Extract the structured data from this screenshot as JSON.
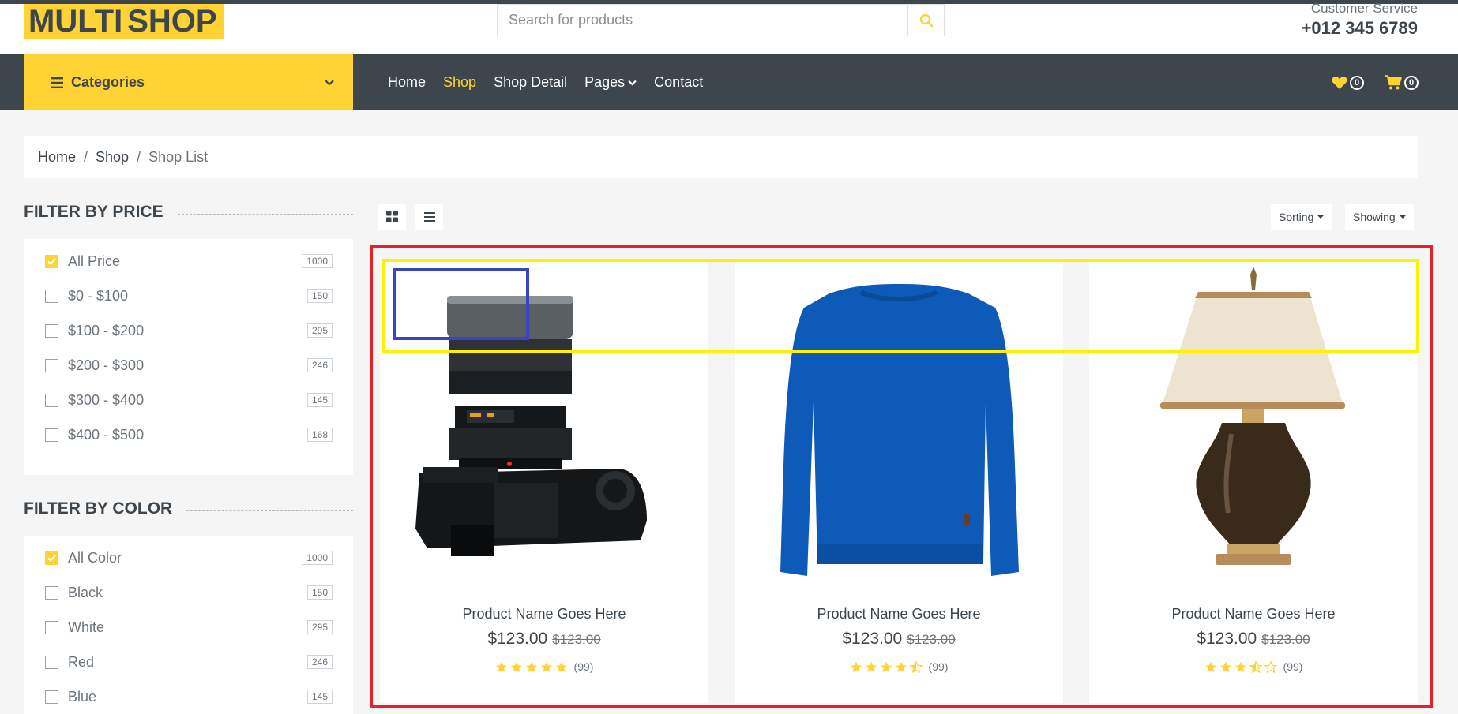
{
  "brand": {
    "part1": "MULTI",
    "part2": "SHOP",
    "accent": "#ffd333",
    "dark": "#3d464d"
  },
  "search": {
    "placeholder": "Search for products"
  },
  "customer_service": {
    "label": "Customer Service",
    "phone": "+012 345 6789"
  },
  "categories": {
    "label": "Categories"
  },
  "nav": {
    "items": [
      {
        "label": "Home"
      },
      {
        "label": "Shop"
      },
      {
        "label": "Shop Detail"
      },
      {
        "label": "Pages"
      },
      {
        "label": "Contact"
      }
    ],
    "active": "Shop",
    "wishlist_count": "0",
    "cart_count": "0"
  },
  "breadcrumb": {
    "items": [
      "Home",
      "Shop"
    ],
    "current": "Shop List",
    "separator": "/"
  },
  "filter_price": {
    "title": "Filter by price",
    "items": [
      {
        "label": "All Price",
        "count": "1000",
        "checked": true
      },
      {
        "label": "$0 - $100",
        "count": "150",
        "checked": false
      },
      {
        "label": "$100 - $200",
        "count": "295",
        "checked": false
      },
      {
        "label": "$200 - $300",
        "count": "246",
        "checked": false
      },
      {
        "label": "$300 - $400",
        "count": "145",
        "checked": false
      },
      {
        "label": "$400 - $500",
        "count": "168",
        "checked": false
      }
    ]
  },
  "filter_color": {
    "title": "Filter by color",
    "items": [
      {
        "label": "All Color",
        "count": "1000",
        "checked": true
      },
      {
        "label": "Black",
        "count": "150",
        "checked": false
      },
      {
        "label": "White",
        "count": "295",
        "checked": false
      },
      {
        "label": "Red",
        "count": "246",
        "checked": false
      },
      {
        "label": "Blue",
        "count": "145",
        "checked": false
      }
    ]
  },
  "toolbar": {
    "sorting_label": "Sorting",
    "showing_label": "Showing"
  },
  "products": [
    {
      "name": "Product Name Goes Here",
      "price": "$123.00",
      "old_price": "$123.00",
      "rating": 5,
      "reviews": "(99)",
      "image": "camera"
    },
    {
      "name": "Product Name Goes Here",
      "price": "$123.00",
      "old_price": "$123.00",
      "rating": 4.5,
      "reviews": "(99)",
      "image": "sweater"
    },
    {
      "name": "Product Name Goes Here",
      "price": "$123.00",
      "old_price": "$123.00",
      "rating": 3.5,
      "reviews": "(99)",
      "image": "lamp"
    }
  ],
  "annotation_colors": {
    "red": "#e8202a",
    "yellow": "#fff200",
    "blue": "#3944c4"
  }
}
